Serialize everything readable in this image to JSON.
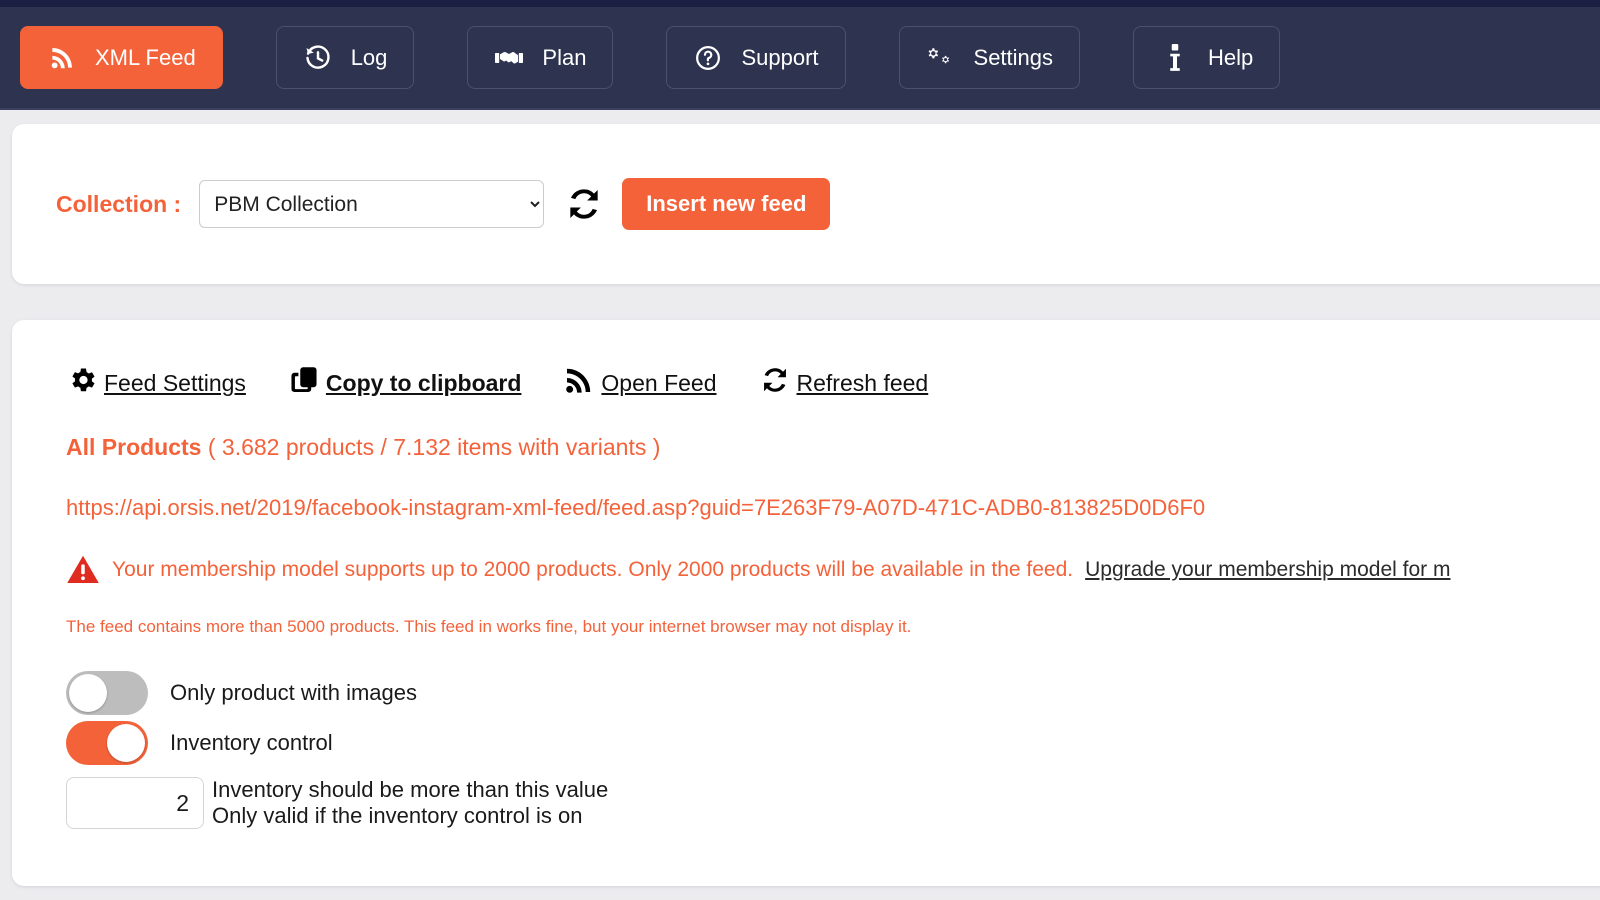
{
  "navbar": {
    "items": [
      {
        "label": "XML Feed",
        "icon": "rss-icon",
        "active": true
      },
      {
        "label": "Log",
        "icon": "history-clock-icon",
        "active": false
      },
      {
        "label": "Plan",
        "icon": "handshake-icon",
        "active": false
      },
      {
        "label": "Support",
        "icon": "question-circle-icon",
        "active": false
      },
      {
        "label": "Settings",
        "icon": "gears-icon",
        "active": false
      },
      {
        "label": "Help",
        "icon": "info-i-icon",
        "active": false
      }
    ]
  },
  "collection_bar": {
    "label": "Collection :",
    "selected": "PBM Collection",
    "options": [
      "PBM Collection"
    ],
    "refresh_icon": "refresh-icon",
    "insert_button": "Insert new feed"
  },
  "feed_panel": {
    "actions": [
      {
        "label": "Feed Settings",
        "icon": "gear-icon",
        "bold": false
      },
      {
        "label": "Copy to clipboard",
        "icon": "copy-icon",
        "bold": true
      },
      {
        "label": "Open Feed",
        "icon": "rss-icon",
        "bold": false
      },
      {
        "label": "Refresh feed",
        "icon": "refresh-icon",
        "bold": false
      }
    ],
    "products_title": "All Products",
    "products_counts": "( 3.682 products / 7.132 items with variants )",
    "feed_url": "https://api.orsis.net/2019/facebook-instagram-xml-feed/feed.asp?guid=7E263F79-A07D-471C-ADB0-813825D0D6F0",
    "warning": {
      "icon": "warning-triangle-icon",
      "text": "Your membership model supports up to 2000 products. Only 2000 products will be available in the feed.",
      "link": "Upgrade your membership model for m"
    },
    "note": "The feed contains more than 5000 products. This feed in works fine, but your internet browser may not display it.",
    "toggles": [
      {
        "label": "Only product with images",
        "on": false
      },
      {
        "label": "Inventory control",
        "on": true
      }
    ],
    "inventory": {
      "value": "2",
      "line1": "Inventory should be more than this value",
      "line2": "Only valid if the inventory control is on"
    }
  },
  "colors": {
    "accent": "#f4623a",
    "navbar": "#2e3450",
    "top_strip": "#1b2042",
    "page_bg": "#ececef",
    "warning_red": "#e02b20"
  }
}
